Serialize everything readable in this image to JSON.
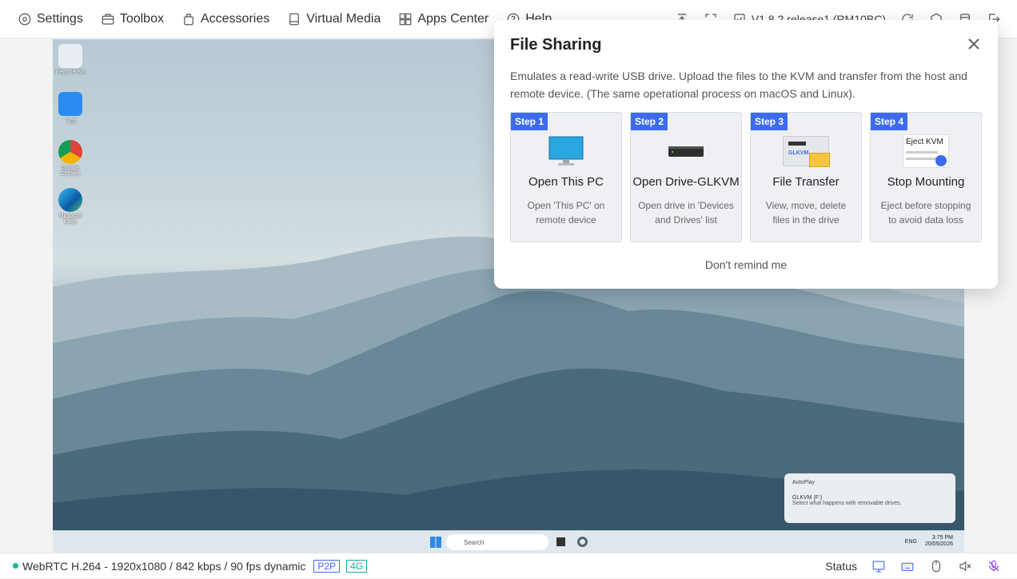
{
  "menu": {
    "items": [
      {
        "label": "Settings",
        "icon": "settings-icon"
      },
      {
        "label": "Toolbox",
        "icon": "toolbox-icon"
      },
      {
        "label": "Accessories",
        "icon": "accessories-icon"
      },
      {
        "label": "Virtual Media",
        "icon": "virtual-media-icon"
      },
      {
        "label": "Apps Center",
        "icon": "apps-center-icon"
      },
      {
        "label": "Help",
        "icon": "help-icon"
      }
    ],
    "version": "V1.8.2 release1 (RM10BC)"
  },
  "modal": {
    "title": "File Sharing",
    "description": "Emulates a read-write USB drive. Upload the files to the KVM and transfer from the host and remote device. (The same operational process on macOS and Linux).",
    "steps": [
      {
        "badge": "Step 1",
        "title": "Open This PC",
        "desc": "Open 'This PC' on remote device",
        "icon": "monitor-icon"
      },
      {
        "badge": "Step 2",
        "title": "Open Drive-GLKVM",
        "desc": "Open drive in 'Devices and Drives' list",
        "icon": "drive-icon"
      },
      {
        "badge": "Step 3",
        "title": "File Transfer",
        "desc": "View, move, delete files in the drive",
        "icon": "folder-icon",
        "img_label": "GLKVM"
      },
      {
        "badge": "Step 4",
        "title": "Stop Mounting",
        "desc": "Eject before stopping to avoid data loss",
        "icon": "eject-icon",
        "img_label": "Eject KVM"
      }
    ],
    "dont_remind": "Don't remind me"
  },
  "remote": {
    "desktop_icons": [
      "Recycle Bin",
      "飞书",
      "Google Chrome",
      "Microsoft Edge"
    ],
    "search_placeholder": "Search",
    "tray_lang": "ENG",
    "tray_time": "3:75 PM",
    "tray_date": "20/05/2026",
    "toast": {
      "app": "AutoPlay",
      "title": "GLKVM (F:)",
      "body": "Select what happens with removable drives."
    }
  },
  "status": {
    "stream": "WebRTC H.264 - 1920x1080 /  842 kbps / 90 fps dynamic",
    "tag_p2p": "P2P",
    "tag_4g": "4G",
    "label": "Status"
  },
  "colors": {
    "accent": "#3d6bf0",
    "online": "#10b9a0"
  }
}
